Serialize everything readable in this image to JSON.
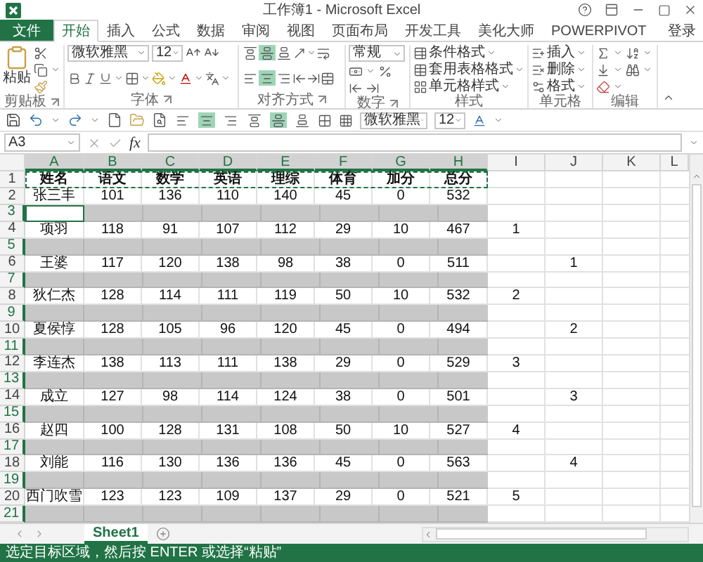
{
  "window": {
    "title": "工作簿1 - Microsoft Excel"
  },
  "ribbon_tabs": [
    {
      "label": "文件",
      "kind": "file",
      "selected": false
    },
    {
      "label": "开始",
      "kind": "tab",
      "selected": true
    },
    {
      "label": "插入",
      "kind": "tab",
      "selected": false
    },
    {
      "label": "公式",
      "kind": "tab",
      "selected": false
    },
    {
      "label": "数据",
      "kind": "tab",
      "selected": false
    },
    {
      "label": "审阅",
      "kind": "tab",
      "selected": false
    },
    {
      "label": "视图",
      "kind": "tab",
      "selected": false
    },
    {
      "label": "页面布局",
      "kind": "tab",
      "selected": false
    },
    {
      "label": "开发工具",
      "kind": "tab",
      "selected": false
    },
    {
      "label": "美化大师",
      "kind": "tab",
      "selected": false
    },
    {
      "label": "POWERPIVOT",
      "kind": "tab",
      "selected": false
    }
  ],
  "account": {
    "label": "登录"
  },
  "ribbon": {
    "clipboard": {
      "paste_label": "粘贴",
      "group_label": "剪贴板"
    },
    "font": {
      "font_name": "微软雅黑",
      "font_size": "12",
      "group_label": "字体"
    },
    "alignment": {
      "vertical": [
        {
          "selected": false
        },
        {
          "selected": true
        },
        {
          "selected": false
        }
      ],
      "horizontal": [
        {
          "selected": false
        },
        {
          "selected": true
        },
        {
          "selected": false
        }
      ],
      "group_label": "对齐方式"
    },
    "number": {
      "format": "常规",
      "group_label": "数字"
    },
    "styles": {
      "commands": [
        "条件格式",
        "套用表格格式",
        "单元格样式"
      ],
      "group_label": "样式"
    },
    "cells": {
      "commands": [
        "插入",
        "删除",
        "格式"
      ],
      "group_label": "单元格"
    },
    "editing": {
      "group_label": "编辑"
    }
  },
  "quick_access": {
    "alignment": [
      {
        "selected": false
      },
      {
        "selected": true
      },
      {
        "selected": false
      },
      {
        "selected": false
      },
      {
        "selected": true
      },
      {
        "selected": false
      }
    ],
    "font_name": "微软雅黑",
    "font_size": "12"
  },
  "formula_bar": {
    "name_box": "A3",
    "function_label": "fx"
  },
  "sheet": {
    "columns": [
      {
        "label": "A",
        "selected": true
      },
      {
        "label": "B",
        "selected": true
      },
      {
        "label": "C",
        "selected": true
      },
      {
        "label": "D",
        "selected": true
      },
      {
        "label": "E",
        "selected": true
      },
      {
        "label": "F",
        "selected": true
      },
      {
        "label": "G",
        "selected": true
      },
      {
        "label": "H",
        "selected": true
      },
      {
        "label": "I",
        "selected": false
      },
      {
        "label": "J",
        "selected": false
      },
      {
        "label": "K",
        "selected": false
      },
      {
        "label": "L",
        "selected": false
      }
    ],
    "rows": [
      {
        "number": "1",
        "kind": "header",
        "selected": false,
        "active": false,
        "copied": true,
        "cells": [
          "姓名",
          "语文",
          "数学",
          "英语",
          "理综",
          "体育",
          "加分",
          "总分"
        ]
      },
      {
        "number": "2",
        "kind": "data",
        "selected": false,
        "active": false,
        "copied": false,
        "cells": [
          "张三丰",
          "101",
          "136",
          "110",
          "140",
          "45",
          "0",
          "532"
        ]
      },
      {
        "number": "3",
        "kind": "blank",
        "selected": true,
        "active": true,
        "copied": false
      },
      {
        "number": "4",
        "kind": "data",
        "selected": false,
        "active": false,
        "copied": false,
        "cells": [
          "项羽",
          "118",
          "91",
          "107",
          "112",
          "29",
          "10",
          "467"
        ],
        "col_i": "1"
      },
      {
        "number": "5",
        "kind": "blank",
        "selected": true,
        "active": false,
        "copied": false
      },
      {
        "number": "6",
        "kind": "data",
        "selected": false,
        "active": false,
        "copied": false,
        "cells": [
          "王婆",
          "117",
          "120",
          "138",
          "98",
          "38",
          "0",
          "511"
        ],
        "col_j": "1"
      },
      {
        "number": "7",
        "kind": "blank",
        "selected": true,
        "active": false,
        "copied": false
      },
      {
        "number": "8",
        "kind": "data",
        "selected": false,
        "active": false,
        "copied": false,
        "cells": [
          "狄仁杰",
          "128",
          "114",
          "111",
          "119",
          "50",
          "10",
          "532"
        ],
        "col_i": "2"
      },
      {
        "number": "9",
        "kind": "blank",
        "selected": true,
        "active": false,
        "copied": false
      },
      {
        "number": "10",
        "kind": "data",
        "selected": false,
        "active": false,
        "copied": false,
        "cells": [
          "夏侯惇",
          "128",
          "105",
          "96",
          "120",
          "45",
          "0",
          "494"
        ],
        "col_j": "2"
      },
      {
        "number": "11",
        "kind": "blank",
        "selected": true,
        "active": false,
        "copied": false
      },
      {
        "number": "12",
        "kind": "data",
        "selected": false,
        "active": false,
        "copied": false,
        "cells": [
          "李连杰",
          "138",
          "113",
          "111",
          "138",
          "29",
          "0",
          "529"
        ],
        "col_i": "3"
      },
      {
        "number": "13",
        "kind": "blank",
        "selected": true,
        "active": false,
        "copied": false
      },
      {
        "number": "14",
        "kind": "data",
        "selected": false,
        "active": false,
        "copied": false,
        "cells": [
          "成立",
          "127",
          "98",
          "114",
          "124",
          "38",
          "0",
          "501"
        ],
        "col_j": "3"
      },
      {
        "number": "15",
        "kind": "blank",
        "selected": true,
        "active": false,
        "copied": false
      },
      {
        "number": "16",
        "kind": "data",
        "selected": false,
        "active": false,
        "copied": false,
        "cells": [
          "赵四",
          "100",
          "128",
          "131",
          "108",
          "50",
          "10",
          "527"
        ],
        "col_i": "4"
      },
      {
        "number": "17",
        "kind": "blank",
        "selected": true,
        "active": false,
        "copied": false
      },
      {
        "number": "18",
        "kind": "data",
        "selected": false,
        "active": false,
        "copied": false,
        "cells": [
          "刘能",
          "116",
          "130",
          "136",
          "136",
          "45",
          "0",
          "563"
        ],
        "col_j": "4"
      },
      {
        "number": "19",
        "kind": "blank",
        "selected": true,
        "active": false,
        "copied": false
      },
      {
        "number": "20",
        "kind": "data",
        "selected": false,
        "active": false,
        "copied": false,
        "cells": [
          "西门吹雪",
          "123",
          "123",
          "109",
          "137",
          "29",
          "0",
          "521"
        ],
        "col_i": "5"
      },
      {
        "number": "21",
        "kind": "blank",
        "selected": true,
        "active": false,
        "copied": false
      }
    ]
  },
  "sheet_tabs": [
    {
      "label": "Sheet1",
      "selected": true
    }
  ],
  "status_bar": {
    "message": "选定目标区域，然后按 ENTER 或选择“粘贴”"
  }
}
